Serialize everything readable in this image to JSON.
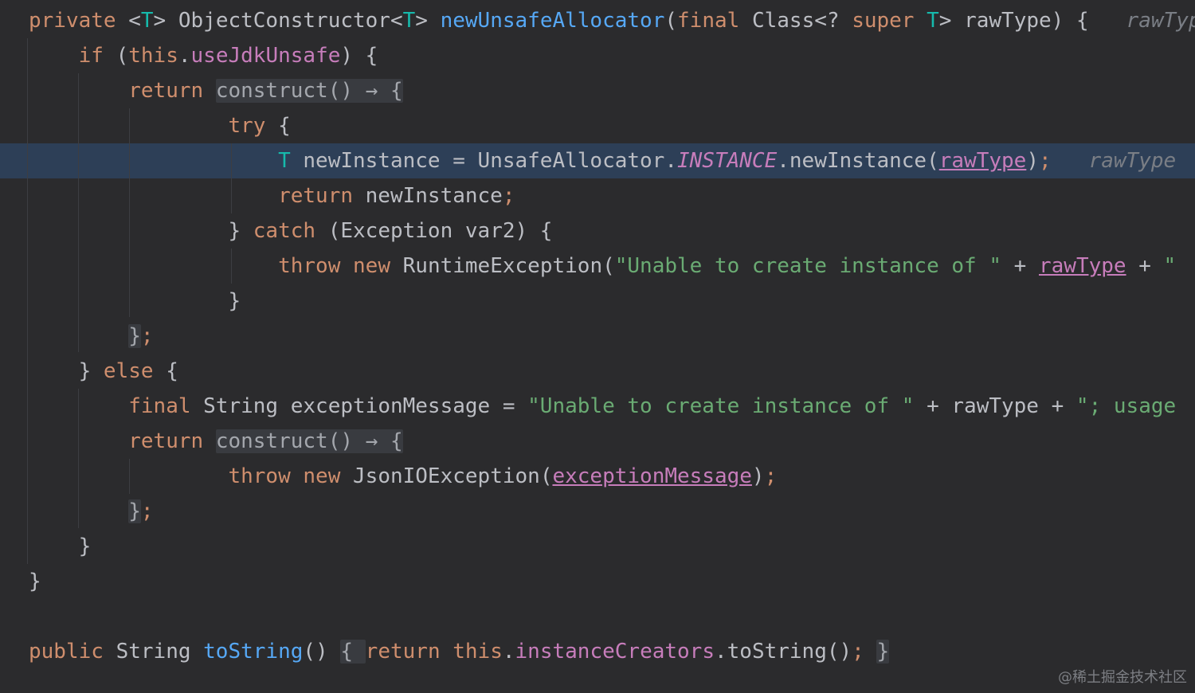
{
  "editor": {
    "lines": [
      {
        "tokens": [
          {
            "t": "private",
            "c": "kw"
          },
          {
            "t": " ",
            "c": "punct"
          },
          {
            "t": "<",
            "c": "punct"
          },
          {
            "t": "T",
            "c": "tp"
          },
          {
            "t": ">",
            "c": "punct"
          },
          {
            "t": " ObjectConstructor",
            "c": "type"
          },
          {
            "t": "<",
            "c": "punct"
          },
          {
            "t": "T",
            "c": "tp"
          },
          {
            "t": "> ",
            "c": "punct"
          },
          {
            "t": "newUnsafeAllocator",
            "c": "fn"
          },
          {
            "t": "(",
            "c": "punct"
          },
          {
            "t": "final",
            "c": "kw"
          },
          {
            "t": " Class<? ",
            "c": "type"
          },
          {
            "t": "super",
            "c": "kw"
          },
          {
            "t": " ",
            "c": "punct"
          },
          {
            "t": "T",
            "c": "tp"
          },
          {
            "t": "> rawType) {",
            "c": "punct"
          },
          {
            "t": "   rawType",
            "c": "hint"
          }
        ]
      },
      {
        "tokens": [
          {
            "t": "    ",
            "c": "punct"
          },
          {
            "t": "if",
            "c": "kw"
          },
          {
            "t": " (",
            "c": "punct"
          },
          {
            "t": "this",
            "c": "kw"
          },
          {
            "t": ".",
            "c": "punct"
          },
          {
            "t": "useJdkUnsafe",
            "c": "field"
          },
          {
            "t": ") {",
            "c": "punct"
          }
        ]
      },
      {
        "tokens": [
          {
            "t": "        ",
            "c": "punct"
          },
          {
            "t": "return",
            "c": "kw"
          },
          {
            "t": " ",
            "c": "punct"
          },
          {
            "t": "construct() → {",
            "c": "fold"
          }
        ]
      },
      {
        "tokens": [
          {
            "t": "                ",
            "c": "punct"
          },
          {
            "t": "try",
            "c": "kw"
          },
          {
            "t": " {",
            "c": "punct"
          }
        ]
      },
      {
        "tokens": [
          {
            "t": "                    ",
            "c": "punct"
          },
          {
            "t": "T",
            "c": "tp"
          },
          {
            "t": " newInstance = UnsafeAllocator.",
            "c": "punct"
          },
          {
            "t": "INSTANCE",
            "c": "static"
          },
          {
            "t": ".newInstance(",
            "c": "punct"
          },
          {
            "t": "rawType",
            "c": "ul"
          },
          {
            "t": ")",
            "c": "punct"
          },
          {
            "t": ";",
            "c": "kw"
          },
          {
            "t": "   rawType",
            "c": "hint"
          }
        ]
      },
      {
        "tokens": [
          {
            "t": "                    ",
            "c": "punct"
          },
          {
            "t": "return",
            "c": "kw"
          },
          {
            "t": " newInstance",
            "c": "punct"
          },
          {
            "t": ";",
            "c": "kw"
          }
        ]
      },
      {
        "tokens": [
          {
            "t": "                } ",
            "c": "punct"
          },
          {
            "t": "catch",
            "c": "kw"
          },
          {
            "t": " (Exception var2) {",
            "c": "punct"
          }
        ]
      },
      {
        "tokens": [
          {
            "t": "                    ",
            "c": "punct"
          },
          {
            "t": "throw",
            "c": "kw"
          },
          {
            "t": " ",
            "c": "punct"
          },
          {
            "t": "new",
            "c": "kw"
          },
          {
            "t": " RuntimeException(",
            "c": "punct"
          },
          {
            "t": "\"Unable to create instance of \"",
            "c": "str"
          },
          {
            "t": " + ",
            "c": "punct"
          },
          {
            "t": "rawType",
            "c": "ul"
          },
          {
            "t": " + ",
            "c": "punct"
          },
          {
            "t": "\"",
            "c": "str"
          }
        ]
      },
      {
        "tokens": [
          {
            "t": "                }",
            "c": "punct"
          }
        ]
      },
      {
        "tokens": [
          {
            "t": "        ",
            "c": "punct"
          },
          {
            "t": "}",
            "c": "fold"
          },
          {
            "t": ";",
            "c": "kw"
          }
        ]
      },
      {
        "tokens": [
          {
            "t": "    } ",
            "c": "punct"
          },
          {
            "t": "else",
            "c": "kw"
          },
          {
            "t": " {",
            "c": "punct"
          }
        ]
      },
      {
        "tokens": [
          {
            "t": "        ",
            "c": "punct"
          },
          {
            "t": "final",
            "c": "kw"
          },
          {
            "t": " String exceptionMessage = ",
            "c": "punct"
          },
          {
            "t": "\"Unable to create instance of \"",
            "c": "str"
          },
          {
            "t": " + rawType + ",
            "c": "punct"
          },
          {
            "t": "\"; usage",
            "c": "str"
          }
        ]
      },
      {
        "tokens": [
          {
            "t": "        ",
            "c": "punct"
          },
          {
            "t": "return",
            "c": "kw"
          },
          {
            "t": " ",
            "c": "punct"
          },
          {
            "t": "construct() → {",
            "c": "fold"
          }
        ]
      },
      {
        "tokens": [
          {
            "t": "                ",
            "c": "punct"
          },
          {
            "t": "throw",
            "c": "kw"
          },
          {
            "t": " ",
            "c": "punct"
          },
          {
            "t": "new",
            "c": "kw"
          },
          {
            "t": " JsonIOException(",
            "c": "punct"
          },
          {
            "t": "exceptionMessage",
            "c": "ul"
          },
          {
            "t": ")",
            "c": "punct"
          },
          {
            "t": ";",
            "c": "kw"
          }
        ]
      },
      {
        "tokens": [
          {
            "t": "        ",
            "c": "punct"
          },
          {
            "t": "}",
            "c": "fold"
          },
          {
            "t": ";",
            "c": "kw"
          }
        ]
      },
      {
        "tokens": [
          {
            "t": "    }",
            "c": "punct"
          }
        ]
      },
      {
        "tokens": [
          {
            "t": "}",
            "c": "punct"
          }
        ]
      },
      {
        "tokens": []
      },
      {
        "tokens": [
          {
            "t": "public",
            "c": "kw"
          },
          {
            "t": " String ",
            "c": "punct"
          },
          {
            "t": "toString",
            "c": "fn"
          },
          {
            "t": "() ",
            "c": "punct"
          },
          {
            "t": "{ ",
            "c": "fold"
          },
          {
            "t": "return",
            "c": "kw"
          },
          {
            "t": " ",
            "c": "punct"
          },
          {
            "t": "this",
            "c": "kw"
          },
          {
            "t": ".",
            "c": "punct"
          },
          {
            "t": "instanceCreators",
            "c": "field"
          },
          {
            "t": ".toString()",
            "c": "punct"
          },
          {
            "t": ";",
            "c": "kw"
          },
          {
            "t": " ",
            "c": "punct"
          },
          {
            "t": "}",
            "c": "fold"
          }
        ]
      }
    ]
  },
  "watermark": "@稀土掘金技术社区"
}
